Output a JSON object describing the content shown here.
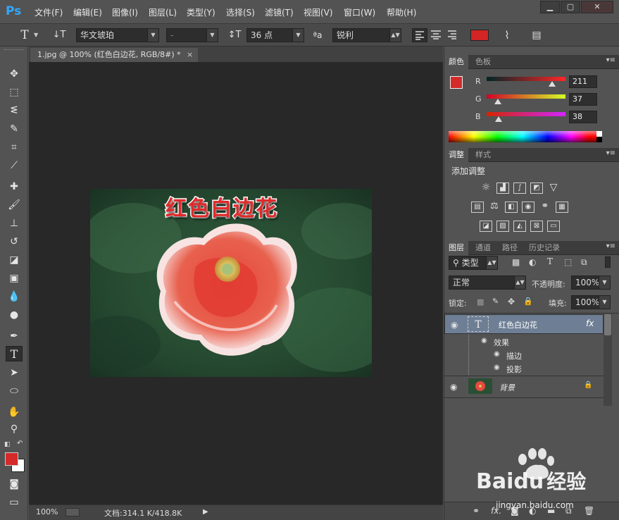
{
  "app": {
    "logo": "Ps",
    "menu": [
      "文件(F)",
      "编辑(E)",
      "图像(I)",
      "图层(L)",
      "类型(Y)",
      "选择(S)",
      "滤镜(T)",
      "视图(V)",
      "窗口(W)",
      "帮助(H)"
    ],
    "window_controls": [
      "▁",
      "▢",
      "✕"
    ]
  },
  "options": {
    "tool_icon": "T",
    "orient_icon": "↓T",
    "font_family": "华文琥珀",
    "font_style": "-",
    "size_icon": "↕T",
    "font_size": "36 点",
    "aa_icon": "ªa",
    "antialias": "锐利",
    "text_color": "#d32525"
  },
  "document": {
    "tab_title": "1.jpg @ 100% (红色白边花, RGB/8#) *",
    "tab_close": "×",
    "text_layer_content": "红色白边花",
    "zoom": "100%",
    "doc_info": "文档:314.1 K/418.8K"
  },
  "tools": {
    "foreground": "#d42a2a",
    "background": "#ffffff"
  },
  "color_panel": {
    "tabs": [
      "颜色",
      "色板"
    ],
    "channels": [
      {
        "label": "R",
        "value": "211",
        "fraction": 0.827
      },
      {
        "label": "G",
        "value": "37",
        "fraction": 0.145
      },
      {
        "label": "B",
        "value": "38",
        "fraction": 0.149
      }
    ]
  },
  "adjust_panel": {
    "tabs": [
      "调整",
      "样式"
    ],
    "title": "添加调整"
  },
  "layers_panel": {
    "tabs": [
      "图层",
      "通道",
      "路径",
      "历史记录"
    ],
    "filter_label": "类型",
    "blend_mode": "正常",
    "opacity_label": "不透明度:",
    "opacity": "100%",
    "lock_label": "锁定:",
    "fill_label": "填充:",
    "fill": "100%",
    "layers": [
      {
        "name": "红色白边花",
        "type": "text",
        "fx": "fx"
      },
      {
        "name": "背景",
        "type": "image"
      }
    ],
    "effects_label": "效果",
    "effects": [
      "描边",
      "投影"
    ]
  },
  "watermark": {
    "brand": "Bai",
    "brand2": "du",
    "cn": "经验",
    "url": "jingyan.baidu.com"
  }
}
